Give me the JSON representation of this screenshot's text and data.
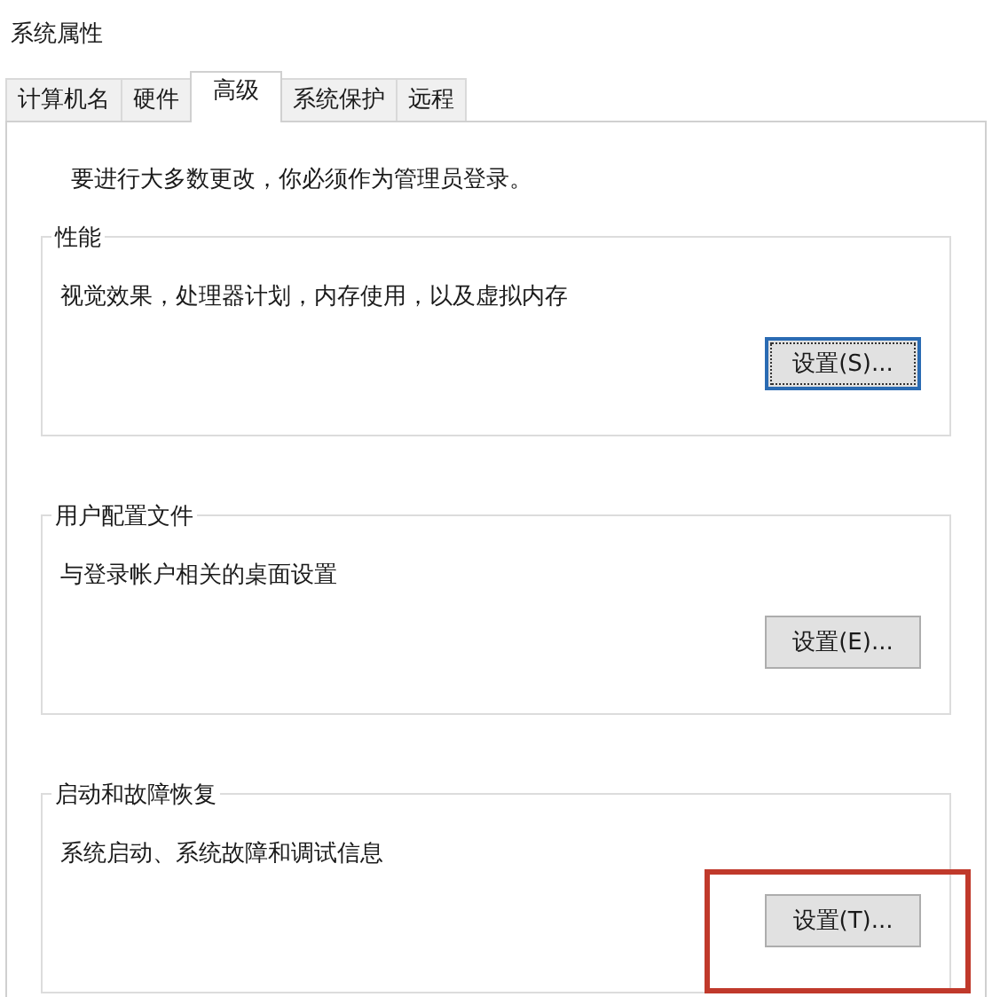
{
  "window": {
    "title": "系统属性"
  },
  "tabs": [
    {
      "label": "计算机名",
      "selected": false
    },
    {
      "label": "硬件",
      "selected": false
    },
    {
      "label": "高级",
      "selected": true
    },
    {
      "label": "系统保护",
      "selected": false
    },
    {
      "label": "远程",
      "selected": false
    }
  ],
  "notice": "要进行大多数更改，你必须作为管理员登录。",
  "groups": [
    {
      "title": "性能",
      "description": "视觉效果，处理器计划，内存使用，以及虚拟内存",
      "button": "设置(S)...",
      "focused": true,
      "highlighted": false
    },
    {
      "title": "用户配置文件",
      "description": "与登录帐户相关的桌面设置",
      "button": "设置(E)...",
      "focused": false,
      "highlighted": false
    },
    {
      "title": "启动和故障恢复",
      "description": "系统启动、系统故障和调试信息",
      "button": "设置(T)...",
      "focused": false,
      "highlighted": true
    }
  ]
}
